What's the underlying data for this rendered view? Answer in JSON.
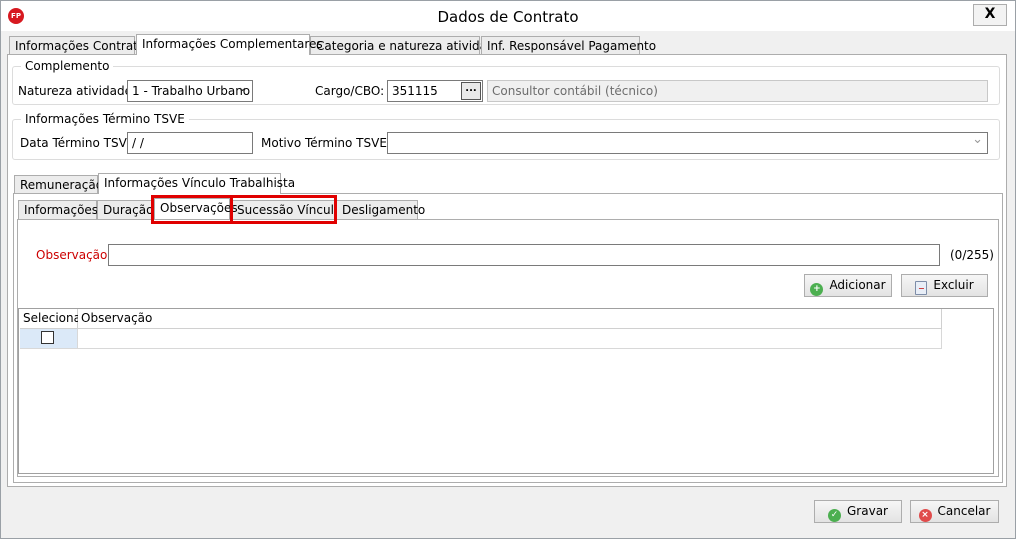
{
  "window": {
    "title": "Dados de Contrato",
    "app_icon_text": "FP",
    "close_label": "X"
  },
  "main_tabs": [
    {
      "label": "Informações Contrato"
    },
    {
      "label": "Informações Complementares"
    },
    {
      "label": "Categoria e natureza atividade"
    },
    {
      "label": "Inf. Responsável Pagamento"
    }
  ],
  "complemento": {
    "legend": "Complemento",
    "natureza_label": "Natureza atividade:",
    "natureza_value": "1 - Trabalho Urbano",
    "cargo_label": "Cargo/CBO:",
    "cargo_value": "351115",
    "cargo_desc": "Consultor contábil (técnico)",
    "ellipsis_label": "..."
  },
  "tsve": {
    "legend": "Informações Término TSVE",
    "data_label": "Data Término TSVE:",
    "data_value": " /  /",
    "motivo_label": "Motivo Término TSVE:",
    "motivo_value": ""
  },
  "sub_tabs": [
    {
      "label": "Remuneração"
    },
    {
      "label": "Informações Vínculo Trabalhista"
    }
  ],
  "inner_tabs": [
    {
      "label": "Informações"
    },
    {
      "label": "Duração"
    },
    {
      "label": "Observações"
    },
    {
      "label": "Sucessão Vínculo"
    },
    {
      "label": "Desligamento"
    }
  ],
  "observacao": {
    "label": "Observação:",
    "value": "",
    "counter": "(0/255)",
    "label_color": "#cc0000"
  },
  "actions": {
    "adicionar": "Adicionar",
    "excluir": "Excluir"
  },
  "grid": {
    "columns": [
      "Selecionar",
      "Observação"
    ],
    "rows": [
      {
        "selected": false,
        "observacao": ""
      }
    ]
  },
  "footer": {
    "gravar": "Gravar",
    "cancelar": "Cancelar"
  },
  "colors": {
    "highlight": "#e00000",
    "selected_row": "#dbe9f8"
  }
}
